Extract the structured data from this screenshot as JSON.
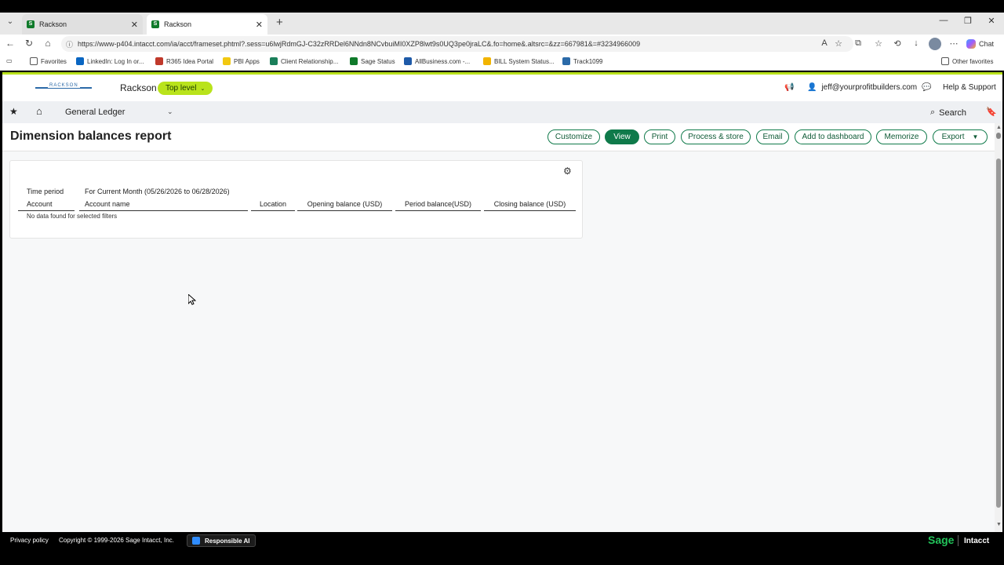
{
  "browser": {
    "tabs": [
      {
        "title": "Rackson",
        "active": false
      },
      {
        "title": "Rackson",
        "active": true
      }
    ],
    "url": "https://www-p404.intacct.com/ia/acct/frameset.phtml?.sess=u6lwjRdmGJ-C32zRRDel6NNdn8NCvbuiMI0XZP8lwt9s0UQ3pe0jraLC&.fo=home&.altsrc=&zz=667981&=#3234966009",
    "chat_label": "Chat",
    "bookmarks": [
      {
        "label": "Favorites",
        "color": "#f0c040"
      },
      {
        "label": "LinkedIn: Log In or...",
        "color": "#0a66c2"
      },
      {
        "label": "R365 Idea Portal",
        "color": "#c0392b"
      },
      {
        "label": "PBI Apps",
        "color": "#f2c811"
      },
      {
        "label": "Client Relationship...",
        "color": "#1a7f5a"
      },
      {
        "label": "Sage Status",
        "color": "#0f7a2a"
      },
      {
        "label": "AllBusiness.com -...",
        "color": "#1e5aa8"
      },
      {
        "label": "BILL System Status...",
        "color": "#f2b400"
      },
      {
        "label": "Track1099",
        "color": "#2b6aa8"
      }
    ],
    "other_favorites": "Other favorites"
  },
  "app": {
    "logo_wordmark": "RACKSON",
    "company": "Rackson",
    "entity_level": "Top level",
    "user_email": "jeff@yourprofitbuilders.com",
    "help_label": "Help & Support",
    "module": "General Ledger",
    "search_label": "Search",
    "page_title": "Dimension balances report",
    "actions": {
      "customize": "Customize",
      "view": "View",
      "print": "Print",
      "process_store": "Process & store",
      "email": "Email",
      "add_dashboard": "Add to dashboard",
      "memorize": "Memorize",
      "export": "Export"
    }
  },
  "report": {
    "time_period_label": "Time period",
    "time_period_value": "For Current Month (05/26/2026 to 06/28/2026)",
    "columns": {
      "account": "Account",
      "account_name": "Account name",
      "location": "Location",
      "opening": "Opening balance (USD)",
      "period": "Period balance(USD)",
      "closing": "Closing balance (USD)"
    },
    "empty_message": "No data found for selected filters"
  },
  "footer": {
    "privacy": "Privacy policy",
    "copyright": "Copyright © 1999-2026 Sage Intacct, Inc.",
    "responsible_ai": "Responsible AI",
    "brand_sage": "Sage",
    "brand_intacct": "Intacct"
  },
  "colors": {
    "accent_green": "#0f7a4a",
    "lime": "#b9e31c"
  }
}
